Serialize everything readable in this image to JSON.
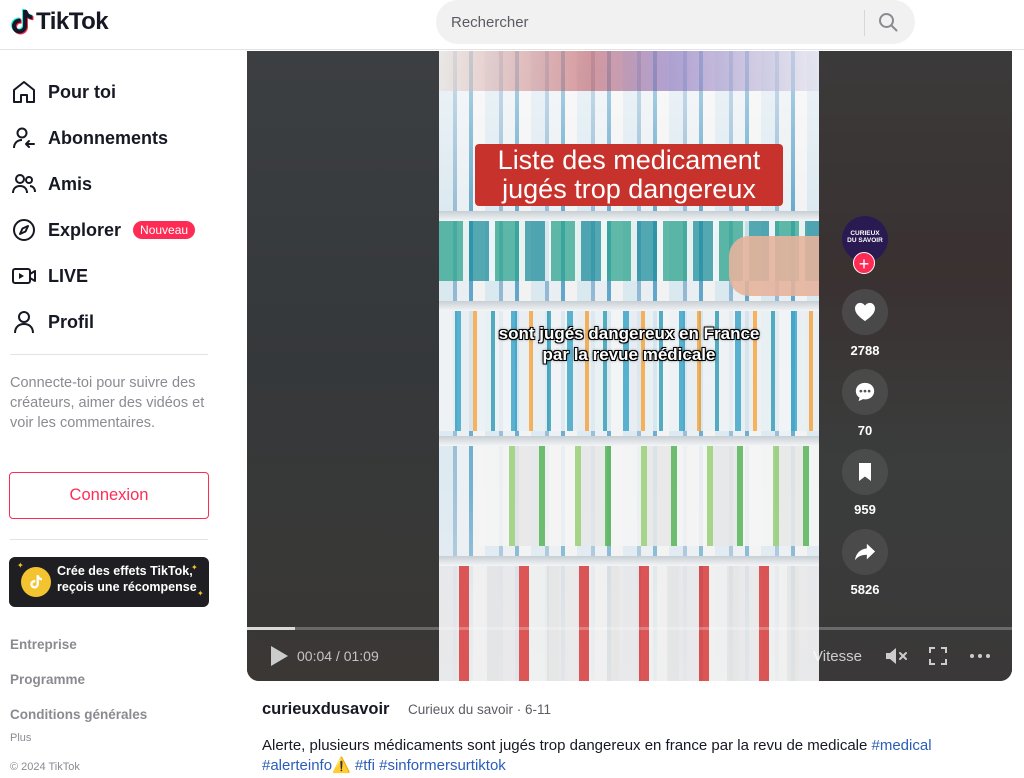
{
  "header": {
    "logo_text": "TikTok",
    "search_placeholder": "Rechercher"
  },
  "sidebar": {
    "nav": [
      {
        "label": "Pour toi"
      },
      {
        "label": "Abonnements"
      },
      {
        "label": "Amis"
      },
      {
        "label": "Explorer",
        "badge": "Nouveau"
      },
      {
        "label": "LIVE"
      },
      {
        "label": "Profil"
      }
    ],
    "login_prompt": "Connecte-toi pour suivre des créateurs, aimer des vidéos et voir les commentaires.",
    "login_button": "Connexion",
    "effects_text": "Crée des effets TikTok, reçois une récompense",
    "footer": {
      "company": "Entreprise",
      "program": "Programme",
      "terms": "Conditions générales",
      "more": "Plus",
      "copyright": "© 2024 TikTok"
    }
  },
  "video": {
    "title_overlay_line1": "Liste des medicament",
    "title_overlay_line2": "jugés trop dangereux",
    "caption_line1": "sont jugés dangereux en France",
    "caption_line2": "par la revue médicale",
    "time": "00:04 / 01:09",
    "speed_label": "Vitesse",
    "progress": 0.063
  },
  "actions": {
    "avatar_text": "CURIEUX DU SAVOIR",
    "likes": "2788",
    "comments": "70",
    "saves": "959",
    "shares": "5826"
  },
  "post": {
    "author": "curieuxdusavoir",
    "author_meta": "Curieux du savoir · 6-11",
    "description": "Alerte, plusieurs médicaments sont jugés trop dangereux en france par la revu de medicale ",
    "tags": [
      "#medical",
      "#alerteinfo",
      "#tfi",
      "#sinformersurtiktok"
    ],
    "warning_emoji": "⚠️"
  },
  "colors": {
    "brand_red": "#fe2c55",
    "title_red": "#c8322d",
    "tag_blue": "#2b5db9"
  }
}
